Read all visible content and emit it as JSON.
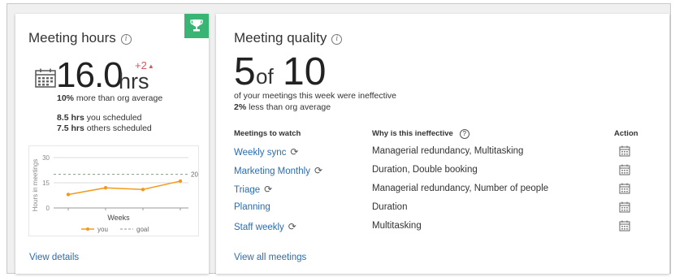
{
  "hours_card": {
    "title": "Meeting hours",
    "info_glyph": "i",
    "trophy_icon": "trophy-icon",
    "value": "16.0",
    "unit": "hrs",
    "delta": "+2",
    "delta_arrow": "▲",
    "comparison_pct": "10%",
    "comparison_text": " more than org average",
    "scheduled_you_value": "8.5 hrs",
    "scheduled_you_text": " you scheduled",
    "scheduled_others_value": "7.5 hrs",
    "scheduled_others_text": " others scheduled",
    "view_details": "View details",
    "colors": {
      "accent_green": "#38b574",
      "delta_red": "#e0515d",
      "line_orange": "#f39a1e"
    }
  },
  "chart_data": {
    "type": "line",
    "title": "",
    "xlabel": "Weeks",
    "ylabel": "Hours in meetings",
    "yticks": [
      "0",
      "15",
      "30"
    ],
    "ylim": [
      0,
      30
    ],
    "x": [
      1,
      2,
      3,
      4
    ],
    "series": [
      {
        "name": "you",
        "values": [
          8,
          12,
          11,
          16
        ]
      }
    ],
    "goal": {
      "name": "goal",
      "value": 20,
      "label": "20"
    },
    "legend": "bottom",
    "grid": true
  },
  "quality_card": {
    "title": "Meeting quality",
    "info_glyph": "i",
    "value": "5",
    "of_text": "of",
    "total": "10",
    "subtitle": "of your meetings this week were ineffective",
    "comparison_pct": "2%",
    "comparison_text": " less than org average",
    "headers": {
      "meetings": "Meetings to watch",
      "why": "Why is this ineffective",
      "why_help": "?",
      "action": "Action"
    },
    "rows": [
      {
        "name": "Weekly sync",
        "recurring": true,
        "why": "Managerial redundancy, Multitasking"
      },
      {
        "name": "Marketing Monthly",
        "recurring": true,
        "why": "Duration, Double booking"
      },
      {
        "name": "Triage",
        "recurring": true,
        "why": "Managerial redundancy, Number of people"
      },
      {
        "name": "Planning",
        "recurring": false,
        "why": "Duration"
      },
      {
        "name": "Staff weekly",
        "recurring": true,
        "why": "Multitasking"
      }
    ],
    "sync_glyph": "⟳",
    "view_all": "View all meetings"
  }
}
